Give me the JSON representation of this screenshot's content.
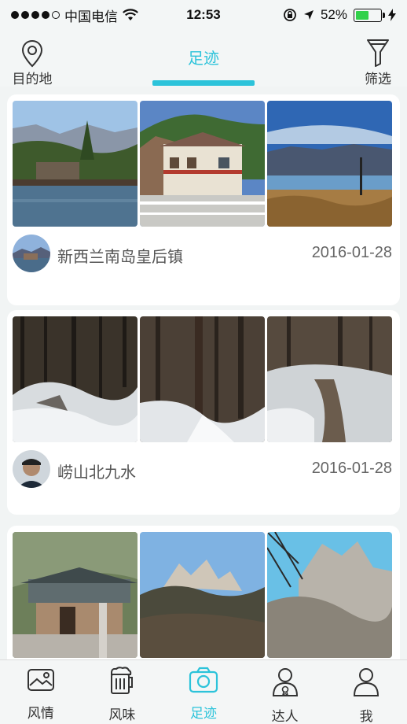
{
  "status_bar": {
    "carrier": "中国电信",
    "time": "12:53",
    "battery": "52%",
    "battery_level": 0.52
  },
  "top_nav": {
    "destination_label": "目的地",
    "title": "足迹",
    "filter_label": "筛选"
  },
  "posts": [
    {
      "place": "新西兰南岛皇后镇",
      "date": "2016-01-28"
    },
    {
      "place": "崂山北九水",
      "date": "2016-01-28"
    },
    {
      "place": "",
      "date": ""
    }
  ],
  "tab_bar": {
    "items": [
      {
        "label": "风情",
        "icon": "picture-icon"
      },
      {
        "label": "风味",
        "icon": "beer-icon"
      },
      {
        "label": "足迹",
        "icon": "camera-icon",
        "active": true
      },
      {
        "label": "达人",
        "icon": "expert-icon"
      },
      {
        "label": "我",
        "icon": "user-icon"
      }
    ]
  },
  "colors": {
    "accent": "#2cc3da",
    "background": "#f1f4f4"
  }
}
